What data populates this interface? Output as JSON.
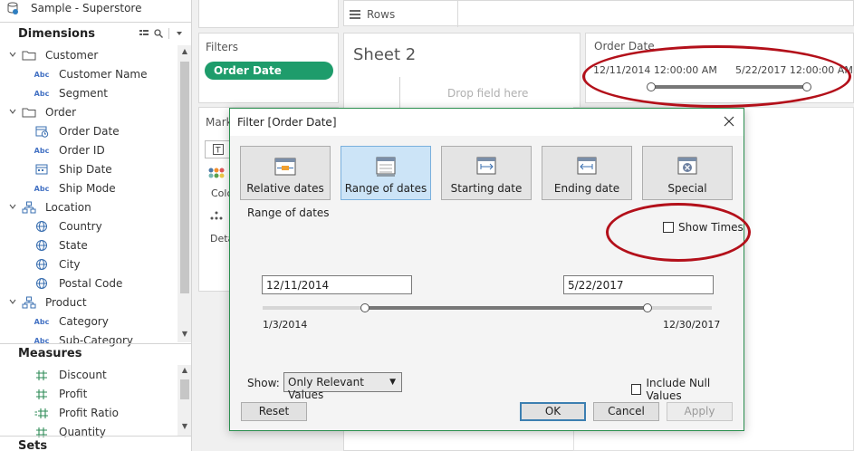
{
  "datasource": {
    "name": "Sample - Superstore"
  },
  "dimensions": {
    "heading": "Dimensions",
    "items": [
      {
        "type": "folder",
        "label": "Customer"
      },
      {
        "type": "abc",
        "icon_text": "Abc",
        "label": "Customer Name"
      },
      {
        "type": "abc",
        "icon_text": "Abc",
        "label": "Segment"
      },
      {
        "type": "folder",
        "label": "Order"
      },
      {
        "type": "datetime",
        "label": "Order Date"
      },
      {
        "type": "abc",
        "icon_text": "Abc",
        "label": "Order ID"
      },
      {
        "type": "date",
        "label": "Ship Date"
      },
      {
        "type": "abc",
        "icon_text": "Abc",
        "label": "Ship Mode"
      },
      {
        "type": "hierarchy",
        "label": "Location"
      },
      {
        "type": "geo",
        "label": "Country"
      },
      {
        "type": "geo",
        "label": "State"
      },
      {
        "type": "geo",
        "label": "City"
      },
      {
        "type": "geo",
        "label": "Postal Code"
      },
      {
        "type": "hierarchy",
        "label": "Product"
      },
      {
        "type": "abc",
        "icon_text": "Abc",
        "label": "Category"
      },
      {
        "type": "abc",
        "icon_text": "Abc",
        "label": "Sub-Category"
      }
    ]
  },
  "measures": {
    "heading": "Measures",
    "items": [
      {
        "type": "measure",
        "label": "Discount"
      },
      {
        "type": "measure",
        "label": "Profit"
      },
      {
        "type": "calc",
        "label": "Profit Ratio"
      },
      {
        "type": "measure",
        "label": "Quantity"
      }
    ]
  },
  "sets": {
    "heading": "Sets"
  },
  "shelves": {
    "rows_label": "Rows",
    "filters_label": "Filters",
    "filter_pill": "Order Date",
    "marks_label": "Mark",
    "color_label": "Colo",
    "detail_label": "Deta"
  },
  "sheet": {
    "title": "Sheet 2",
    "drop_hint": "Drop field here"
  },
  "quick_filter": {
    "title": "Order Date",
    "start": "12/11/2014 12:00:00 AM",
    "end": "5/22/2017 12:00:00 AM"
  },
  "dialog": {
    "title": "Filter [Order Date]",
    "tabs": [
      {
        "label": "Relative dates",
        "icon": "relative-dates-icon",
        "active": false
      },
      {
        "label": "Range of dates",
        "icon": "range-of-dates-icon",
        "active": true
      },
      {
        "label": "Starting date",
        "icon": "starting-date-icon",
        "active": false
      },
      {
        "label": "Ending date",
        "icon": "ending-date-icon",
        "active": false
      },
      {
        "label": "Special",
        "icon": "special-icon",
        "active": false
      }
    ],
    "range_heading": "Range of dates",
    "show_times_label": "Show Times",
    "show_times_checked": false,
    "start_date": "12/11/2014",
    "end_date": "5/22/2017",
    "min_date": "1/3/2014",
    "max_date": "12/30/2017",
    "show_label": "Show:",
    "show_value": "Only Relevant Values",
    "include_null_label": "Include Null Values",
    "include_null_checked": false,
    "buttons": {
      "reset": "Reset",
      "ok": "OK",
      "cancel": "Cancel",
      "apply": "Apply"
    }
  },
  "colors": {
    "accent_green": "#1e9c6b",
    "annotation_red": "#b3101a",
    "active_tab": "#cce4f7"
  }
}
